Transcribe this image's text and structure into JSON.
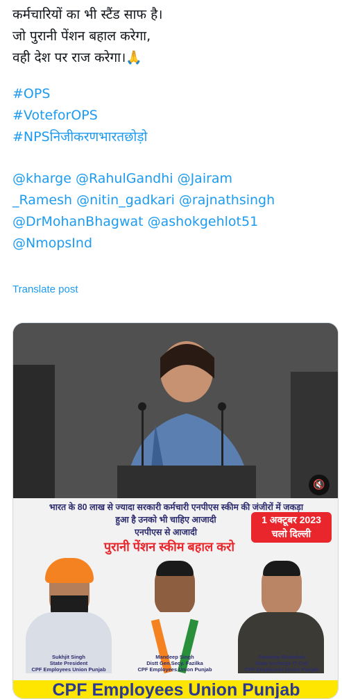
{
  "post": {
    "lines": [
      "कर्मचारियों का भी स्टैंड साफ है।",
      "जो पुरानी पेंशन बहाल करेगा,",
      "वही देश पर राज करेगा।🙏"
    ],
    "hashtags": [
      "#OPS",
      "#VoteforOPS",
      "#NPSनिजीकरणभारतछोड़ो"
    ],
    "mention_lines": [
      "@kharge @RahulGandhi @Jairam",
      "_Ramesh @nitin_gadkari @rajnathsingh",
      "@DrMohanBhagwat @ashokgehlot51",
      "@NmopsInd"
    ],
    "translate_label": "Translate post"
  },
  "media": {
    "mute_icon": "🔇",
    "poster": {
      "line1": "भारत के 80 लाख से ज्यादा सरकारी कर्मचारी एनपीएस स्कीम की जंजीरों में जकड़ा",
      "line2": "हुआ है उनको भी चाहिए आजादी",
      "line3": "एनपीएस से आजादी",
      "date_line1": "1 अक्टूबर 2023",
      "date_line2": "चलो दिल्ली",
      "slogan": "पुरानी पेंशन स्कीम बहाल करो",
      "people": [
        {
          "name": "Sukhjit Singh",
          "role": "State President",
          "org": "CPF Employees Union Punjab"
        },
        {
          "name": "Mandeep Singh",
          "role": "Distt Gen.Secy. Fazilka",
          "org": "CPF Employees Union Punjab"
        },
        {
          "name": "Sandeep Bhambah",
          "role": "State Incharge IT Cell",
          "org": "CPF Employees Union Punjab"
        }
      ],
      "banner": "CPF Employees Union Punjab"
    }
  },
  "colors": {
    "link": "#1d9bf0",
    "poster_red": "#e8262c",
    "banner_yellow": "#ffe600",
    "banner_text": "#2b3a8f"
  }
}
